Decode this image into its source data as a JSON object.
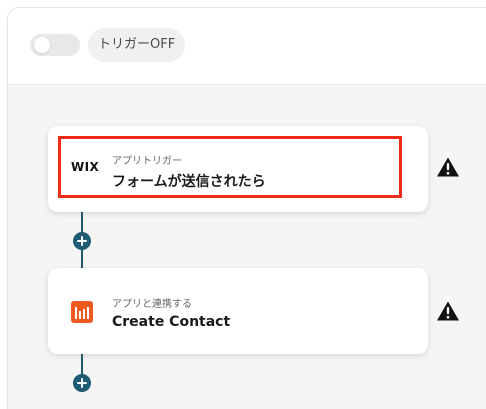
{
  "header": {
    "toggle_label": "トリガーOFF"
  },
  "flow": {
    "steps": [
      {
        "app_logo_text": "WIX",
        "subtitle": "アプリトリガー",
        "title": "フォームが送信されたら"
      },
      {
        "subtitle": "アプリと連携する",
        "title": "Create Contact"
      }
    ]
  },
  "icons": {
    "warning": "warning-icon",
    "add": "plus-icon",
    "trigger_app": "wix-logo",
    "action_app": "app-icon"
  },
  "colors": {
    "accent": "#1f5c73",
    "highlight_border": "#ef2b17",
    "warning": "#111111",
    "app_icon": "#ef5a20"
  }
}
